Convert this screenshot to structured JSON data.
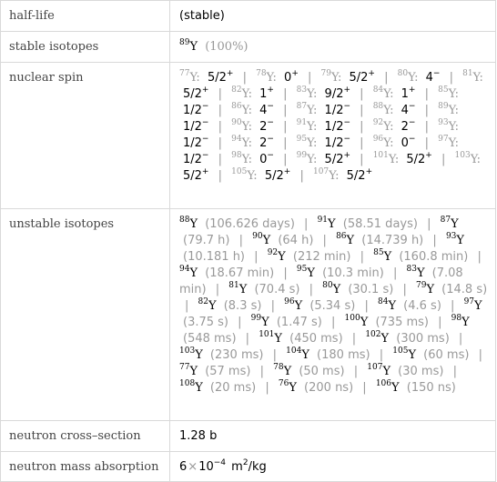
{
  "rows": {
    "half_life": {
      "label": "half-life",
      "value": "(stable)"
    },
    "stable_isotopes": {
      "label": "stable isotopes",
      "mass": "89",
      "symbol": "Y",
      "abundance": "(100%)"
    },
    "nuclear_spin": {
      "label": "nuclear spin",
      "entries": [
        {
          "mass": "77",
          "symbol": "Y:",
          "spin": "5/2",
          "parity": "+"
        },
        {
          "mass": "78",
          "symbol": "Y:",
          "spin": "0",
          "parity": "+"
        },
        {
          "mass": "79",
          "symbol": "Y:",
          "spin": "5/2",
          "parity": "+"
        },
        {
          "mass": "80",
          "symbol": "Y:",
          "spin": "4",
          "parity": "−"
        },
        {
          "mass": "81",
          "symbol": "Y:",
          "spin": "5/2",
          "parity": "+"
        },
        {
          "mass": "82",
          "symbol": "Y:",
          "spin": "1",
          "parity": "+"
        },
        {
          "mass": "83",
          "symbol": "Y:",
          "spin": "9/2",
          "parity": "+"
        },
        {
          "mass": "84",
          "symbol": "Y:",
          "spin": "1",
          "parity": "+"
        },
        {
          "mass": "85",
          "symbol": "Y:",
          "spin": "1/2",
          "parity": "−"
        },
        {
          "mass": "86",
          "symbol": "Y:",
          "spin": "4",
          "parity": "−"
        },
        {
          "mass": "87",
          "symbol": "Y:",
          "spin": "1/2",
          "parity": "−"
        },
        {
          "mass": "88",
          "symbol": "Y:",
          "spin": "4",
          "parity": "−"
        },
        {
          "mass": "89",
          "symbol": "Y:",
          "spin": "1/2",
          "parity": "−"
        },
        {
          "mass": "90",
          "symbol": "Y:",
          "spin": "2",
          "parity": "−"
        },
        {
          "mass": "91",
          "symbol": "Y:",
          "spin": "1/2",
          "parity": "−"
        },
        {
          "mass": "92",
          "symbol": "Y:",
          "spin": "2",
          "parity": "−"
        },
        {
          "mass": "93",
          "symbol": "Y:",
          "spin": "1/2",
          "parity": "−"
        },
        {
          "mass": "94",
          "symbol": "Y:",
          "spin": "2",
          "parity": "−"
        },
        {
          "mass": "95",
          "symbol": "Y:",
          "spin": "1/2",
          "parity": "−"
        },
        {
          "mass": "96",
          "symbol": "Y:",
          "spin": "0",
          "parity": "−"
        },
        {
          "mass": "97",
          "symbol": "Y:",
          "spin": "1/2",
          "parity": "−"
        },
        {
          "mass": "98",
          "symbol": "Y:",
          "spin": "0",
          "parity": "−"
        },
        {
          "mass": "99",
          "symbol": "Y:",
          "spin": "5/2",
          "parity": "+"
        },
        {
          "mass": "101",
          "symbol": "Y:",
          "spin": "5/2",
          "parity": "+"
        },
        {
          "mass": "103",
          "symbol": "Y:",
          "spin": "5/2",
          "parity": "+"
        },
        {
          "mass": "105",
          "symbol": "Y:",
          "spin": "5/2",
          "parity": "+"
        },
        {
          "mass": "107",
          "symbol": "Y:",
          "spin": "5/2",
          "parity": "+"
        }
      ]
    },
    "unstable_isotopes": {
      "label": "unstable isotopes",
      "entries": [
        {
          "mass": "88",
          "symbol": "Y",
          "half_life": "(106.626 days)"
        },
        {
          "mass": "91",
          "symbol": "Y",
          "half_life": "(58.51 days)"
        },
        {
          "mass": "87",
          "symbol": "Y",
          "half_life": "(79.7 h)"
        },
        {
          "mass": "90",
          "symbol": "Y",
          "half_life": "(64 h)"
        },
        {
          "mass": "86",
          "symbol": "Y",
          "half_life": "(14.739 h)"
        },
        {
          "mass": "93",
          "symbol": "Y",
          "half_life": "(10.181 h)"
        },
        {
          "mass": "92",
          "symbol": "Y",
          "half_life": "(212 min)"
        },
        {
          "mass": "85",
          "symbol": "Y",
          "half_life": "(160.8 min)"
        },
        {
          "mass": "94",
          "symbol": "Y",
          "half_life": "(18.67 min)"
        },
        {
          "mass": "95",
          "symbol": "Y",
          "half_life": "(10.3 min)"
        },
        {
          "mass": "83",
          "symbol": "Y",
          "half_life": "(7.08 min)"
        },
        {
          "mass": "81",
          "symbol": "Y",
          "half_life": "(70.4 s)"
        },
        {
          "mass": "80",
          "symbol": "Y",
          "half_life": "(30.1 s)"
        },
        {
          "mass": "79",
          "symbol": "Y",
          "half_life": "(14.8 s)"
        },
        {
          "mass": "82",
          "symbol": "Y",
          "half_life": "(8.3 s)"
        },
        {
          "mass": "96",
          "symbol": "Y",
          "half_life": "(5.34 s)"
        },
        {
          "mass": "84",
          "symbol": "Y",
          "half_life": "(4.6 s)"
        },
        {
          "mass": "97",
          "symbol": "Y",
          "half_life": "(3.75 s)"
        },
        {
          "mass": "99",
          "symbol": "Y",
          "half_life": "(1.47 s)"
        },
        {
          "mass": "100",
          "symbol": "Y",
          "half_life": "(735 ms)"
        },
        {
          "mass": "98",
          "symbol": "Y",
          "half_life": "(548 ms)"
        },
        {
          "mass": "101",
          "symbol": "Y",
          "half_life": "(450 ms)"
        },
        {
          "mass": "102",
          "symbol": "Y",
          "half_life": "(300 ms)"
        },
        {
          "mass": "103",
          "symbol": "Y",
          "half_life": "(230 ms)"
        },
        {
          "mass": "104",
          "symbol": "Y",
          "half_life": "(180 ms)"
        },
        {
          "mass": "105",
          "symbol": "Y",
          "half_life": "(60 ms)"
        },
        {
          "mass": "77",
          "symbol": "Y",
          "half_life": "(57 ms)"
        },
        {
          "mass": "78",
          "symbol": "Y",
          "half_life": "(50 ms)"
        },
        {
          "mass": "107",
          "symbol": "Y",
          "half_life": "(30 ms)"
        },
        {
          "mass": "108",
          "symbol": "Y",
          "half_life": "(20 ms)"
        },
        {
          "mass": "76",
          "symbol": "Y",
          "half_life": "(200 ns)"
        },
        {
          "mass": "106",
          "symbol": "Y",
          "half_life": "(150 ns)"
        }
      ]
    },
    "neutron_cross_section": {
      "label": "neutron cross–section",
      "value": "1.28 b"
    },
    "neutron_mass_absorption": {
      "label": "neutron mass absorption",
      "coefficient": "6",
      "times": "×",
      "base": "10",
      "exponent": "−4",
      "unit": "m",
      "unit_exp": "2",
      "unit_rest": "/kg"
    }
  },
  "separator": "|"
}
